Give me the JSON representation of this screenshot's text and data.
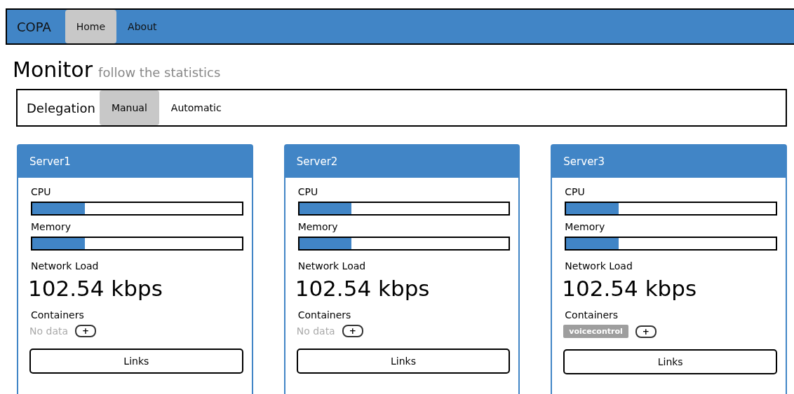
{
  "navbar": {
    "brand": "COPA",
    "items": [
      {
        "label": "Home",
        "selected": true
      },
      {
        "label": "About",
        "selected": false
      }
    ]
  },
  "page": {
    "title": "Monitor",
    "subtitle": "follow the statistics"
  },
  "delegation": {
    "label": "Delegation",
    "options": [
      {
        "label": "Manual",
        "selected": true
      },
      {
        "label": "Automatic",
        "selected": false
      }
    ]
  },
  "servers": [
    {
      "name": "Server1",
      "cpu_label": "CPU",
      "cpu": {
        "level": 0.25
      },
      "memory_label": "Memory",
      "memory": {
        "level": 0.25
      },
      "network_label": "Network Load",
      "network": "102.54 kbps",
      "containers_label": "Containers",
      "empty_text": "No data",
      "add": "+",
      "links": "Links"
    },
    {
      "name": "Server2",
      "cpu_label": "CPU",
      "cpu": {
        "level": 0.25
      },
      "memory_label": "Memory",
      "memory": {
        "level": 0.25
      },
      "network_label": "Network Load",
      "network": "102.54 kbps",
      "containers_label": "Containers",
      "empty_text": "No data",
      "add": "+",
      "links": "Links"
    },
    {
      "name": "Server3",
      "cpu_label": "CPU",
      "cpu": {
        "level": 0.25
      },
      "memory_label": "Memory",
      "memory": {
        "level": 0.25
      },
      "network_label": "Network Load",
      "network": "102.54 kbps",
      "containers_label": "Containers",
      "containers": [
        "voicecontrol"
      ],
      "add": "+",
      "links": "Links"
    }
  ]
}
